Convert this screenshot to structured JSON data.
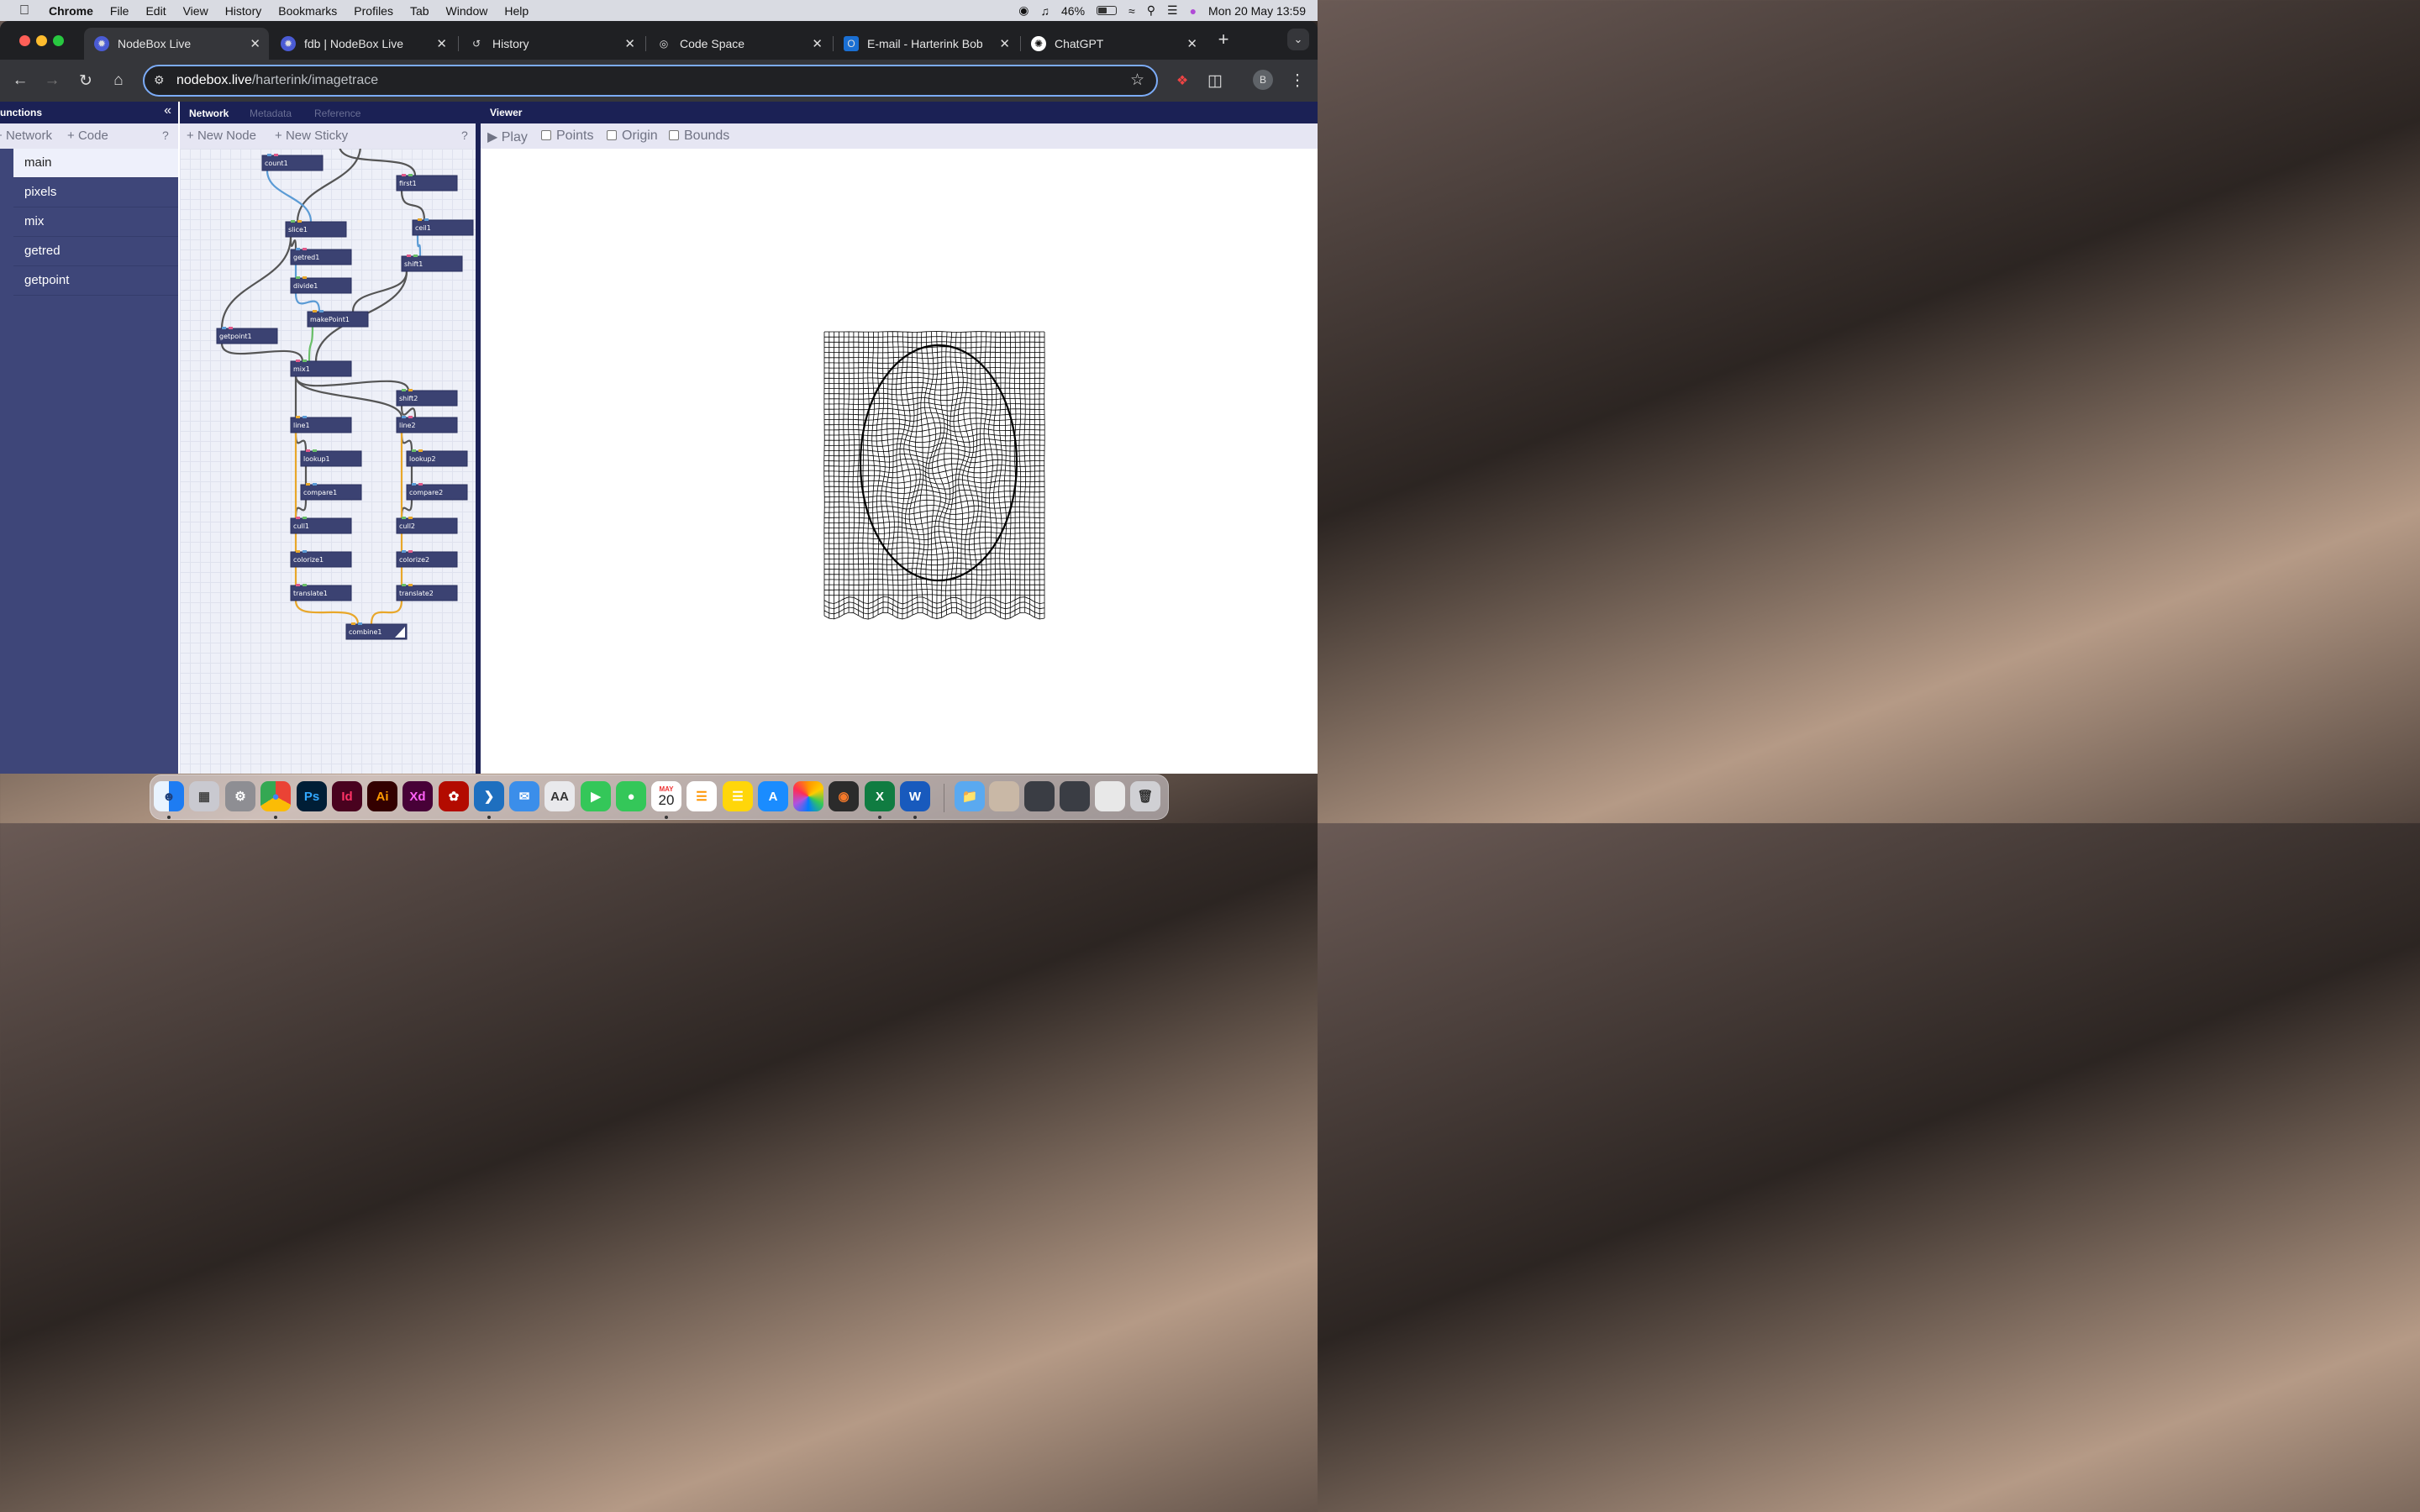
{
  "menubar": {
    "app": "Chrome",
    "items": [
      "File",
      "Edit",
      "View",
      "History",
      "Bookmarks",
      "Profiles",
      "Tab",
      "Window",
      "Help"
    ],
    "battery": "46%",
    "clock": "Mon 20 May  13:59"
  },
  "browser": {
    "tabs": [
      {
        "title": "NodeBox Live",
        "icon": "nodebox-icon"
      },
      {
        "title": "fdb | NodeBox Live",
        "icon": "nodebox-icon"
      },
      {
        "title": "History",
        "icon": "history-icon"
      },
      {
        "title": "Code Space",
        "icon": "globe-icon"
      },
      {
        "title": "E-mail - Harterink Bob",
        "icon": "outlook-icon"
      },
      {
        "title": "ChatGPT",
        "icon": "chatgpt-icon"
      }
    ],
    "url_host": "nodebox.live",
    "url_path": "/harterink/imagetrace",
    "profile_initial": "B"
  },
  "functions_panel": {
    "title": "unctions",
    "add_network": "Network",
    "add_code": "Code",
    "help": "?",
    "items": [
      "main",
      "pixels",
      "mix",
      "getred",
      "getpoint"
    ],
    "selected": "main"
  },
  "network_panel": {
    "tabs": [
      "Network",
      "Metadata",
      "Reference"
    ],
    "active_tab": "Network",
    "new_node": "New Node",
    "new_sticky": "New Sticky",
    "help": "?",
    "nodes": [
      "count1",
      "first1",
      "slice1",
      "ceil1",
      "getred1",
      "shift1",
      "divide1",
      "makePoint1",
      "getpoint1",
      "mix1",
      "shift2",
      "line1",
      "line2",
      "lookup1",
      "lookup2",
      "compare1",
      "compare2",
      "cull1",
      "cull2",
      "colorize1",
      "colorize2",
      "translate1",
      "translate2",
      "combine1"
    ],
    "rendered_node": "combine1"
  },
  "viewer": {
    "title": "Viewer",
    "play": "Play",
    "points": "Points",
    "origin": "Origin",
    "bounds": "Bounds",
    "points_checked": false,
    "origin_checked": false,
    "bounds_checked": false
  },
  "dock": {
    "apps": [
      "Finder",
      "Launchpad",
      "System Settings",
      "Chrome",
      "Photoshop",
      "InDesign",
      "Illustrator",
      "XD",
      "Acrobat",
      "VS Code",
      "Mail",
      "Font Book",
      "FaceTime",
      "Messages",
      "Calendar",
      "Reminders",
      "Notes",
      "App Store",
      "Photos",
      "Blender",
      "Excel",
      "Word"
    ],
    "calendar_month": "MAY",
    "calendar_day": "20"
  },
  "colors": {
    "panel_dark": "#1b2155",
    "panel_list": "#3e4679",
    "node_fill": "#3b4272",
    "wire_grey": "#555555",
    "wire_blue": "#5b9bd5",
    "wire_green": "#6abf69",
    "wire_orange": "#e8a72a"
  }
}
